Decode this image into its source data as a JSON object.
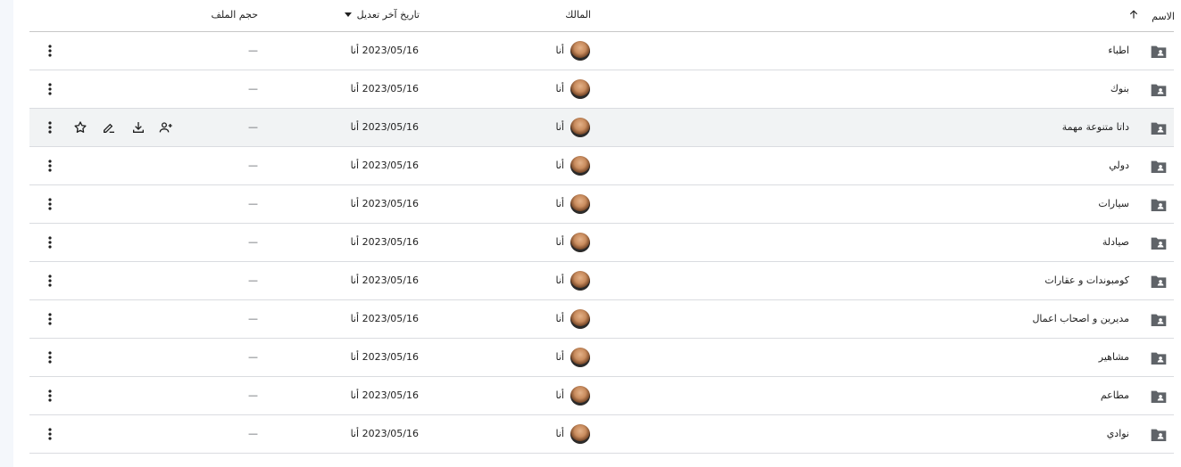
{
  "columns": {
    "name": "الاسم",
    "owner": "المالك",
    "modified": "تاريخ آخر تعديل",
    "size": "حجم الملف"
  },
  "rows": [
    {
      "name": "اطباء",
      "owner": "أنا",
      "modified": "2023/05/16 أنا",
      "size": "—"
    },
    {
      "name": "بنوك",
      "owner": "أنا",
      "modified": "2023/05/16 أنا",
      "size": "—"
    },
    {
      "name": "داتا متنوعة مهمة",
      "owner": "أنا",
      "modified": "2023/05/16 أنا",
      "size": "—"
    },
    {
      "name": "دولي",
      "owner": "أنا",
      "modified": "2023/05/16 أنا",
      "size": "—"
    },
    {
      "name": "سيارات",
      "owner": "أنا",
      "modified": "2023/05/16 أنا",
      "size": "—"
    },
    {
      "name": "صيادلة",
      "owner": "أنا",
      "modified": "2023/05/16 أنا",
      "size": "—"
    },
    {
      "name": "كومبوندات و عقارات",
      "owner": "أنا",
      "modified": "2023/05/16 أنا",
      "size": "—"
    },
    {
      "name": "مديرين و اصحاب اعمال",
      "owner": "أنا",
      "modified": "2023/05/16 أنا",
      "size": "—"
    },
    {
      "name": "مشاهير",
      "owner": "أنا",
      "modified": "2023/05/16 أنا",
      "size": "—"
    },
    {
      "name": "مطاعم",
      "owner": "أنا",
      "modified": "2023/05/16 أنا",
      "size": "—"
    },
    {
      "name": "نوادي",
      "owner": "أنا",
      "modified": "2023/05/16 أنا",
      "size": "—"
    }
  ],
  "hovered_row_index": 2,
  "icons": {
    "sort": "arrow-up-icon",
    "sort_menu": "caret-down-icon",
    "folder": "shared-folder-icon",
    "more": "more-vert-icon",
    "row_actions": [
      "share-icon",
      "download-icon",
      "rename-icon",
      "star-icon"
    ]
  },
  "colors": {
    "hover_row": "#f1f3f4",
    "icon": "#5f6368",
    "border": "#dadce0"
  }
}
